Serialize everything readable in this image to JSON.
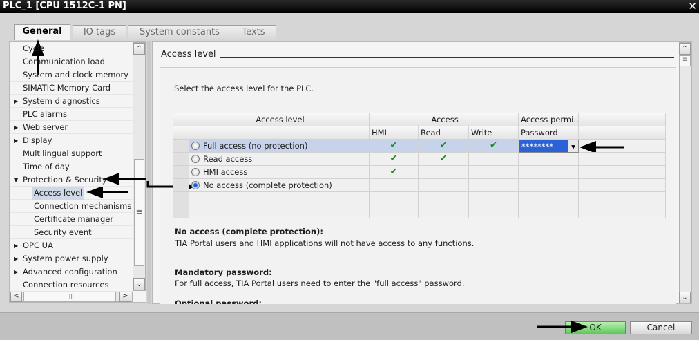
{
  "window": {
    "title": "PLC_1 [CPU 1512C-1 PN]",
    "close": "✕"
  },
  "tabs": [
    "General",
    "IO tags",
    "System constants",
    "Texts"
  ],
  "tree": [
    {
      "label": "Cycle",
      "indent": 0,
      "arrow": ""
    },
    {
      "label": "Communication load",
      "indent": 0,
      "arrow": ""
    },
    {
      "label": "System and clock memory",
      "indent": 0,
      "arrow": ""
    },
    {
      "label": "SIMATIC Memory Card",
      "indent": 0,
      "arrow": ""
    },
    {
      "label": "System diagnostics",
      "indent": 0,
      "arrow": "▶"
    },
    {
      "label": "PLC alarms",
      "indent": 0,
      "arrow": ""
    },
    {
      "label": "Web server",
      "indent": 0,
      "arrow": "▶"
    },
    {
      "label": "Display",
      "indent": 0,
      "arrow": "▶"
    },
    {
      "label": "Multilingual support",
      "indent": 0,
      "arrow": ""
    },
    {
      "label": "Time of day",
      "indent": 0,
      "arrow": ""
    },
    {
      "label": "Protection & Security",
      "indent": 0,
      "arrow": "▼"
    },
    {
      "label": "Access level",
      "indent": 1,
      "arrow": "",
      "selected": true
    },
    {
      "label": "Connection mechanisms",
      "indent": 1,
      "arrow": ""
    },
    {
      "label": "Certificate manager",
      "indent": 1,
      "arrow": ""
    },
    {
      "label": "Security event",
      "indent": 1,
      "arrow": ""
    },
    {
      "label": "OPC UA",
      "indent": 0,
      "arrow": "▶"
    },
    {
      "label": "System power supply",
      "indent": 0,
      "arrow": "▶"
    },
    {
      "label": "Advanced configuration",
      "indent": 0,
      "arrow": "▶"
    },
    {
      "label": "Connection resources",
      "indent": 0,
      "arrow": ""
    }
  ],
  "section": {
    "title": "Access level",
    "intro": "Select the access level for the PLC."
  },
  "table": {
    "h1": {
      "level": "Access level",
      "access": "Access",
      "perm": "Access permi..."
    },
    "h2": {
      "hmi": "HMI",
      "read": "Read",
      "write": "Write",
      "password": "Password"
    },
    "check": "✔",
    "rows": [
      {
        "label": "Full access (no protection)",
        "hmi": true,
        "read": true,
        "write": true,
        "password": "********",
        "selected": false,
        "highlight": true
      },
      {
        "label": "Read access",
        "hmi": true,
        "read": true,
        "write": false,
        "password": "",
        "selected": false
      },
      {
        "label": "HMI access",
        "hmi": true,
        "read": false,
        "write": false,
        "password": "",
        "selected": false
      },
      {
        "label": "No access (complete protection)",
        "hmi": false,
        "read": false,
        "write": false,
        "password": "",
        "selected": true
      }
    ]
  },
  "desc": {
    "no_access_title": "No access (complete protection):",
    "no_access_text": "TIA Portal users and HMI applications will not have access to any functions.",
    "mandatory_title": "Mandatory password:",
    "mandatory_text": "For full access, TIA Portal users need to enter the \"full access\" password.",
    "optional_title": "Optional password:"
  },
  "buttons": {
    "ok": "OK",
    "cancel": "Cancel"
  }
}
